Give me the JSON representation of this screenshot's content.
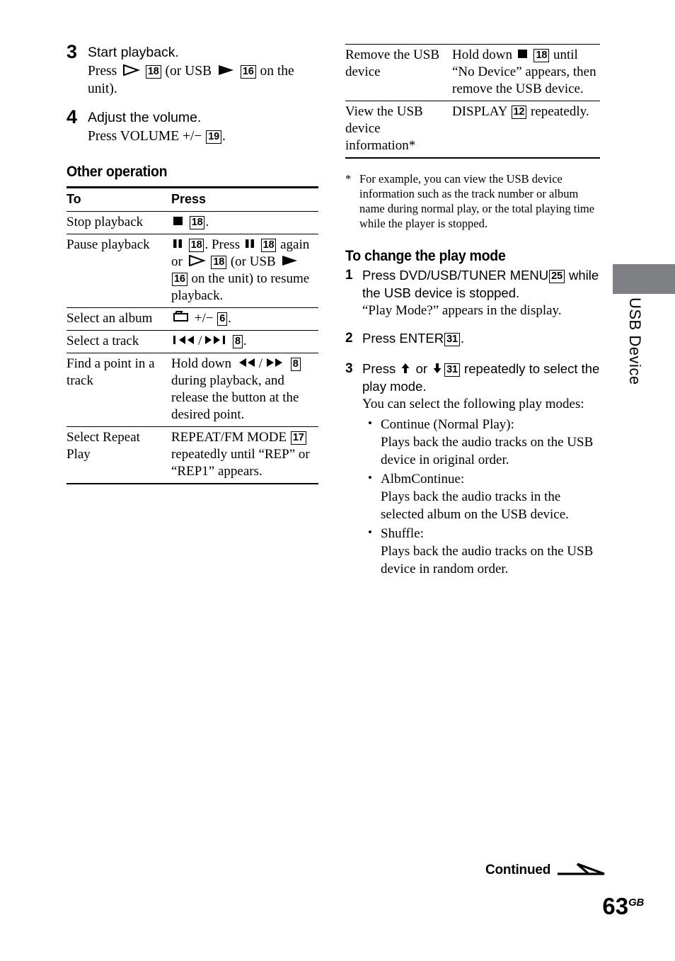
{
  "page": {
    "number": "63",
    "region_suffix": "GB",
    "continued_label": "Continued",
    "side_tab_label": "USB Device",
    "tab_color": "#7e8083"
  },
  "left_column": {
    "steps": [
      {
        "num": "3",
        "title": "Start playback.",
        "sub_prefix": "Press",
        "sub_icon_1": "play-outline-icon",
        "sub_ref_1": "18",
        "sub_mid": "(or USB",
        "sub_icon_2": "play-filled-icon",
        "sub_ref_2": "16",
        "sub_suffix": "on the unit)."
      },
      {
        "num": "4",
        "title": "Adjust the volume.",
        "sub_prefix": "Press VOLUME +/−",
        "sub_ref_1": "19",
        "sub_suffix": "."
      }
    ],
    "section_heading": "Other operation",
    "table": {
      "headers": [
        "To",
        "Press"
      ],
      "rows": [
        {
          "to": "Stop playback",
          "press_parts": [
            "stop-icon",
            "18",
            "."
          ]
        },
        {
          "to": "Pause playback",
          "press_text_a": ". Press",
          "press_text_b": "again or",
          "press_text_c": "(or USB",
          "press_text_d": "on the unit) to resume playback.",
          "refs": [
            "18",
            "18",
            "18",
            "16"
          ]
        },
        {
          "to": "Select an album",
          "press_text": "+/−",
          "ref": "6",
          "icon": "folder-icon"
        },
        {
          "to": "Select a track",
          "icons": [
            "prev-track-icon",
            "next-track-icon"
          ],
          "separator": "/",
          "ref": "8"
        },
        {
          "to": "Find a point in a track",
          "press_text_a": "Hold down",
          "press_text_b": "during playback, and release the button at the desired point.",
          "icons": [
            "rewind-icon",
            "fast-forward-icon"
          ],
          "separator": "/",
          "ref": "8"
        },
        {
          "to": "Select Repeat Play",
          "press_text_a": "REPEAT/FM MODE",
          "press_text_b": "repeatedly until “REP” or “REP1” appears.",
          "ref": "17"
        }
      ]
    }
  },
  "right_column": {
    "table": {
      "rows": [
        {
          "to": "Remove the USB device",
          "press_text_a": "Hold down",
          "press_text_b": "until “No Device” appears, then remove the USB device.",
          "ref": "18",
          "icon": "stop-icon"
        },
        {
          "to": "View the USB device information*",
          "press_text_a": "DISPLAY",
          "press_text_b": "repeatedly.",
          "ref": "12"
        }
      ]
    },
    "footnote": {
      "mark": "*",
      "text": "For example, you can view the USB device information such as the track number or album name during normal play, or the total playing time while the player is stopped."
    },
    "section_heading": "To change the play mode",
    "procedure": [
      {
        "num": "1",
        "text_a": "Press DVD/USB/TUNER MENU",
        "ref": "25",
        "text_b": "while the USB device is stopped.",
        "note": "“Play Mode?” appears in the display."
      },
      {
        "num": "2",
        "text_a": "Press ENTER",
        "ref": "31",
        "text_b": "."
      },
      {
        "num": "3",
        "text_a": "Press",
        "icon_up": "arrow-up-icon",
        "text_or": "or",
        "icon_down": "arrow-down-icon",
        "ref": "31",
        "text_b": "repeatedly to select the play mode.",
        "note": "You can select the following play modes:",
        "modes": [
          {
            "name": "Continue (Normal Play):",
            "desc": "Plays back the audio tracks on the USB device in original order."
          },
          {
            "name": "AlbmContinue:",
            "desc": "Plays back the audio tracks in the selected album on the USB device."
          },
          {
            "name": "Shuffle:",
            "desc": "Plays back the audio tracks on the USB device in random order."
          }
        ]
      }
    ]
  }
}
